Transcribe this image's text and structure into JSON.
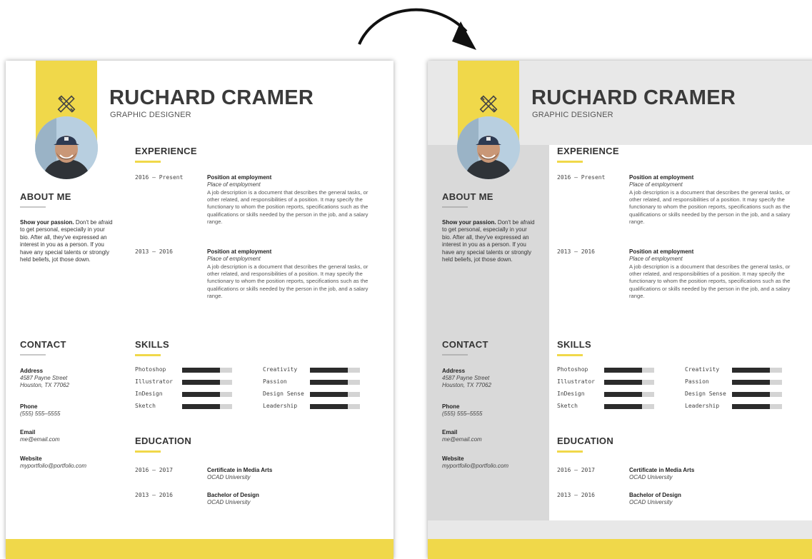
{
  "colors": {
    "accent": "#f0d84a",
    "dark": "#2b2b2b",
    "panel": "#d9d9d9"
  },
  "icons": {
    "logo": "crossed-tools-icon",
    "arrow": "curved-arrow-icon"
  },
  "resume": {
    "name": "RUCHARD CRAMER",
    "role": "GRAPHIC DESIGNER",
    "about_title": "ABOUT ME",
    "about_lead": "Show your passion.",
    "about_text": "Don't be afraid to get personal, especially in your bio. After all, they've expressed an interest in you as a person. If you have any special talents or strongly held beliefs, jot those down.",
    "experience_title": "EXPERIENCE",
    "experience": [
      {
        "dates": "2016 – Present",
        "title": "Position at employment",
        "place": "Place of employment",
        "desc": "A job description is a document that describes the general tasks, or other related, and responsibilities of a position. It may specify the functionary to whom the position reports, specifications such as the qualifications or skills needed by the person in the job, and a salary range."
      },
      {
        "dates": "2013 – 2016",
        "title": "Position at employment",
        "place": "Place of employment",
        "desc": "A job description is a document that describes the general tasks, or other related, and responsibilities of a position. It may specify the functionary to whom the position reports, specifications such as the qualifications or skills needed by the person in the job, and a salary range."
      }
    ],
    "contact_title": "CONTACT",
    "contact": {
      "address_label": "Address",
      "address_line1": "4587 Payne Street",
      "address_line2": "Houston, TX 77062",
      "phone_label": "Phone",
      "phone": "(555) 555–5555",
      "email_label": "Email",
      "email": "me@email.com",
      "website_label": "Website",
      "website": "myportfolio@portfolio.com"
    },
    "skills_title": "SKILLS",
    "skills": [
      {
        "name": "Photoshop",
        "level": 0.75
      },
      {
        "name": "Illustrator",
        "level": 0.75
      },
      {
        "name": "InDesign",
        "level": 0.75
      },
      {
        "name": "Sketch",
        "level": 0.75
      },
      {
        "name": "Creativity",
        "level": 0.75
      },
      {
        "name": "Passion",
        "level": 0.75
      },
      {
        "name": "Design Sense",
        "level": 0.75
      },
      {
        "name": "Leadership",
        "level": 0.75
      }
    ],
    "education_title": "EDUCATION",
    "education": [
      {
        "dates": "2016 – 2017",
        "degree": "Certificate in Media Arts",
        "school": "OCAD University"
      },
      {
        "dates": "2013 – 2016",
        "degree": "Bachelor of Design",
        "school": "OCAD University"
      }
    ]
  }
}
